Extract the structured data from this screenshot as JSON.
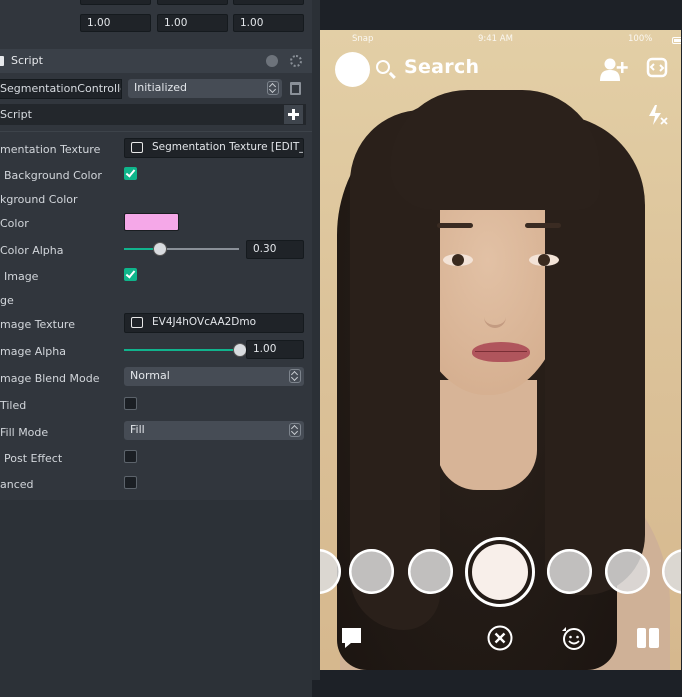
{
  "inspector": {
    "vector_row": {
      "x": "1.00",
      "y": "1.00",
      "z": "1.00"
    },
    "component": {
      "title": "Script",
      "script_name": "SegmentationController",
      "state_dropdown": "Initialized",
      "sub_label": "Script"
    },
    "props": [
      {
        "label": "mentation Texture"
      },
      {
        "label": "Background Color"
      },
      {
        "label": "kground Color"
      },
      {
        "label": "Color"
      },
      {
        "label": "Color Alpha"
      },
      {
        "label": "Image"
      },
      {
        "label": "ge"
      },
      {
        "label": "mage Texture"
      },
      {
        "label": "mage Alpha"
      },
      {
        "label": "mage Blend Mode"
      },
      {
        "label": "Tiled"
      },
      {
        "label": "Fill Mode"
      },
      {
        "label": "Post Effect"
      },
      {
        "label": "anced"
      }
    ],
    "segmentation_texture_value": "Segmentation Texture [EDIT_ME]",
    "color_alpha_value": "0.30",
    "color_alpha_level": 0.3,
    "image_texture_value": "EV4J4hOVcAA2Dmo",
    "image_alpha_value": "1.00",
    "image_alpha_level": 1.0,
    "blend_mode_value": "Normal",
    "fill_mode_value": "Fill",
    "swatch_color": "#f5a8e8",
    "accent_color": "#0fb58b"
  },
  "preview": {
    "status_left": "Snap",
    "status_time": "9:41 AM",
    "status_right": "100%",
    "search_label": "Search"
  }
}
